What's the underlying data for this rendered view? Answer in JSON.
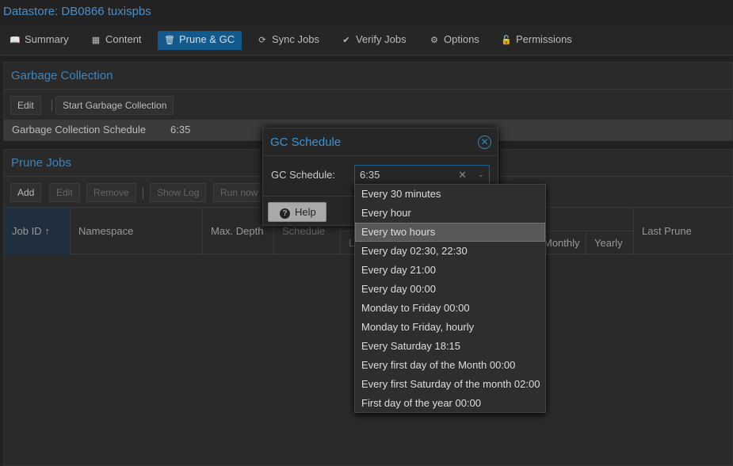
{
  "header": {
    "title": "Datastore: DB0866  tuxispbs"
  },
  "tabs": [
    {
      "label": "Summary",
      "icon": "book-icon"
    },
    {
      "label": "Content",
      "icon": "grid-icon"
    },
    {
      "label": "Prune & GC",
      "icon": "trash-icon",
      "active": true
    },
    {
      "label": "Sync Jobs",
      "icon": "refresh-icon"
    },
    {
      "label": "Verify Jobs",
      "icon": "check-circle-icon"
    },
    {
      "label": "Options",
      "icon": "gear-icon"
    },
    {
      "label": "Permissions",
      "icon": "unlock-icon"
    }
  ],
  "gc": {
    "title": "Garbage Collection",
    "edit": "Edit",
    "start": "Start Garbage Collection",
    "schedule_label": "Garbage Collection Schedule",
    "schedule_value": "6:35"
  },
  "prune": {
    "title": "Prune Jobs",
    "add": "Add",
    "edit": "Edit",
    "remove": "Remove",
    "show_log": "Show Log",
    "run_now": "Run now",
    "columns": {
      "job_id": "Job ID ↑",
      "namespace": "Namespace",
      "max_depth": "Max. Depth",
      "schedule": "Schedule",
      "last": "L",
      "monthly": "Monthly",
      "yearly": "Yearly",
      "last_prune": "Last Prune"
    }
  },
  "dialog": {
    "title": "GC Schedule",
    "field_label": "GC Schedule:",
    "field_value": "6:35",
    "help": "Help"
  },
  "dropdown": {
    "highlighted": 2,
    "options": [
      "Every 30 minutes",
      "Every hour",
      "Every two hours",
      "Every day 02:30, 22:30",
      "Every day 21:00",
      "Every day 00:00",
      "Monday to Friday 00:00",
      "Monday to Friday, hourly",
      "Every Saturday 18:15",
      "Every first day of the Month 00:00",
      "Every first Saturday of the month 02:00",
      "First day of the year 00:00"
    ]
  }
}
